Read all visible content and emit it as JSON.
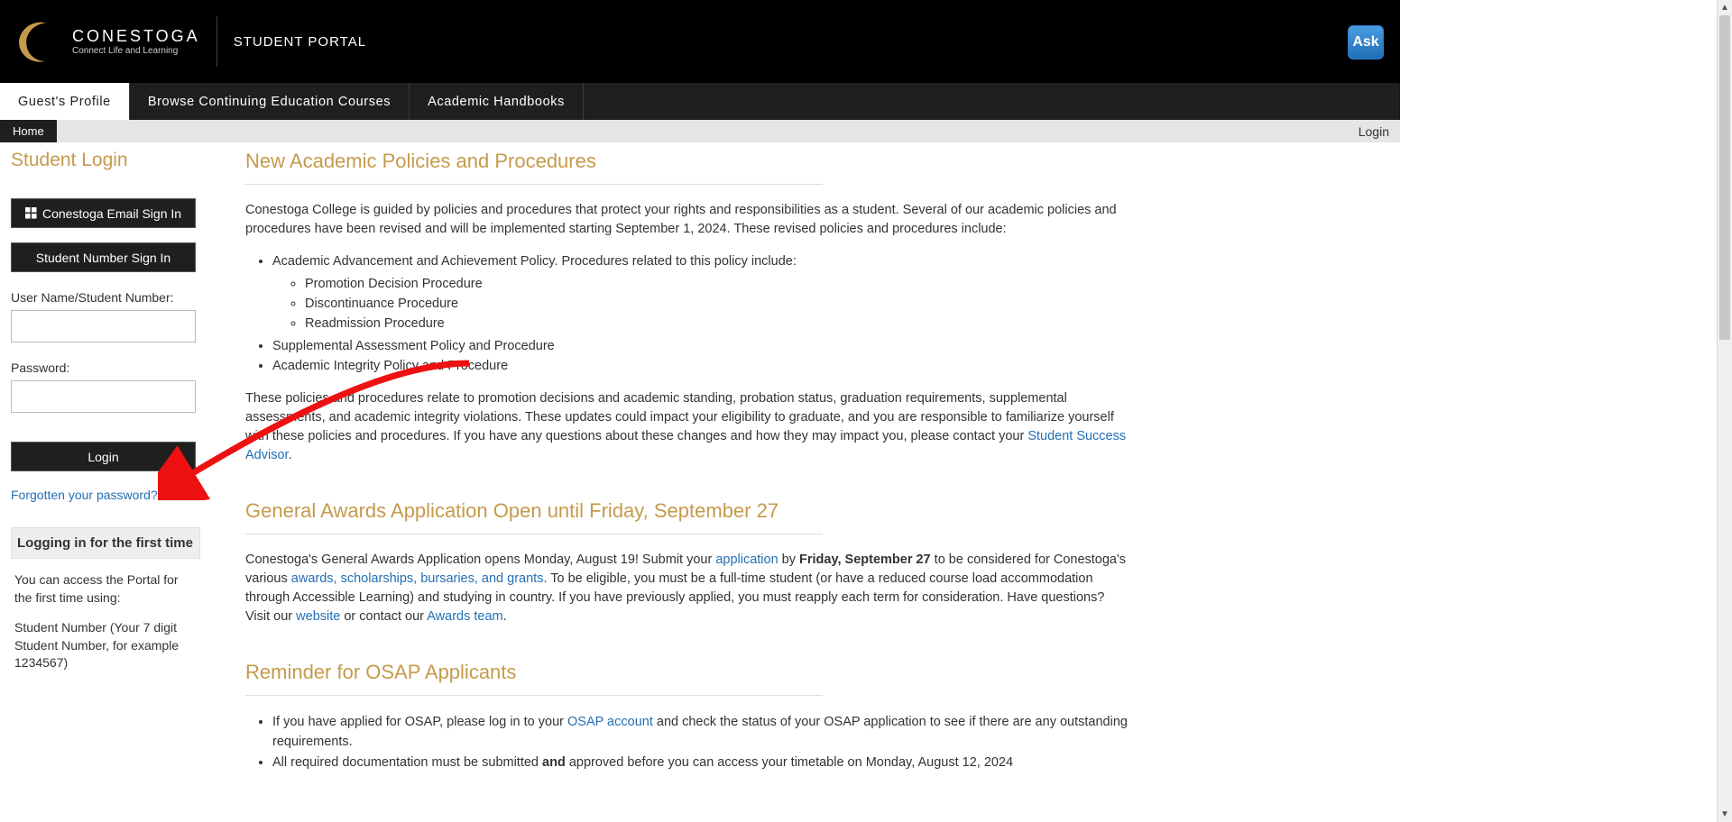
{
  "header": {
    "brand": "CONESTOGA",
    "tagline": "Connect Life and Learning",
    "portal": "STUDENT PORTAL",
    "ask": "Ask"
  },
  "nav": {
    "tabs": [
      "Guest's Profile",
      "Browse Continuing Education Courses",
      "Academic Handbooks"
    ],
    "subtab": "Home",
    "login_link": "Login"
  },
  "sidebar": {
    "title": "Student Login",
    "email_btn": "Conestoga Email Sign In",
    "number_btn": "Student Number Sign In",
    "user_label": "User Name/Student Number:",
    "pass_label": "Password:",
    "login_btn": "Login",
    "forgot": "Forgotten your password?",
    "first_time_heading": "Logging in for the first time",
    "first_time_p1": "You can access the Portal for the first time using:",
    "first_time_p2": "Student Number (Your 7 digit Student Number, for example 1234567)"
  },
  "main": {
    "s1_title": "New Academic Policies and Procedures",
    "s1_p1": "Conestoga College is guided by policies and procedures that protect your rights and responsibilities as a student. Several of our academic policies and procedures have been revised and will be implemented starting September 1, 2024. These revised policies and procedures include:",
    "s1_b1": "Academic Advancement and Achievement Policy. Procedures related to this policy include:",
    "s1_b1a": "Promotion Decision Procedure",
    "s1_b1b": "Discontinuance Procedure",
    "s1_b1c": "Readmission Procedure",
    "s1_b2": "Supplemental Assessment Policy and Procedure",
    "s1_b3": "Academic Integrity Policy and Procedure",
    "s1_p2a": "These policies and procedures relate to promotion decisions and academic standing, probation status, graduation requirements, supplemental assessments, and academic integrity violations. These updates could impact your eligibility to graduate, and you are responsible to familiarize yourself with these policies and procedures. If you have any questions about these changes and how they may impact you, please contact your ",
    "s1_link": "Student Success Advisor",
    "s1_p2b": ".",
    "s2_title": "General Awards Application Open until Friday, September 27",
    "s2_p1a": "Conestoga's General Awards Application opens Monday, August 19! Submit your ",
    "s2_link_app": "application",
    "s2_p1b": " by ",
    "s2_bold": "Friday, September 27",
    "s2_p1c": " to be considered for Conestoga's various ",
    "s2_link_awards": "awards, scholarships, bursaries, and grants",
    "s2_p1d": ". To be eligible, you must be a full-time student (or have a reduced course load accommodation through Accessible Learning) and studying in country. If you have previously applied, you must reapply each term for consideration. Have questions? Visit our ",
    "s2_link_site": "website",
    "s2_p1e": " or contact our ",
    "s2_link_team": "Awards team",
    "s2_p1f": ".",
    "s3_title": "Reminder for OSAP Applicants",
    "s3_b1a": "If you have applied for OSAP, please log in to your ",
    "s3_link_osap": "OSAP account",
    "s3_b1b": " and check the status of your OSAP application to see if there are any outstanding requirements.",
    "s3_b2a": "All required documentation must be submitted ",
    "s3_bold_and": "and",
    "s3_b2b": " approved before you can access your timetable on Monday, August 12, 2024"
  }
}
